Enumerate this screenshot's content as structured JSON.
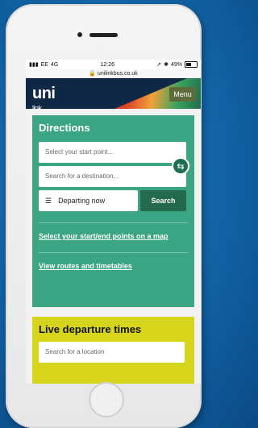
{
  "status_bar": {
    "carrier": "EE",
    "network": "4G",
    "time": "12:26",
    "battery": "49%"
  },
  "url": "🔒 unilinkbus.co.uk",
  "header": {
    "logo_bold": "uni",
    "logo_light": "link",
    "menu_label": "Menu"
  },
  "directions": {
    "title": "Directions",
    "start_placeholder": "Select your start point...",
    "destination_placeholder": "Search for a destination...",
    "swap_icon": "⇆",
    "departing_label": "Departing now",
    "search_label": "Search",
    "map_link": "Select your start/end points on a map",
    "routes_link": "View routes and timetables"
  },
  "live": {
    "title": "Live departure times",
    "search_placeholder": "Search for a location"
  },
  "colors": {
    "directions_bg": "#3ba583",
    "live_bg": "#d7d51b",
    "header_navy": "#0e2846",
    "search_btn": "#246a4f"
  }
}
